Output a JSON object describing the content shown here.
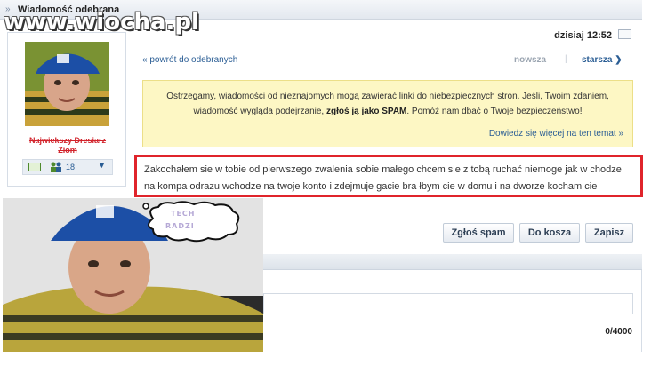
{
  "window": {
    "title": "Wiadomość odebrana"
  },
  "watermark": "www.wiocha.pl",
  "sender": {
    "nick": "Najwiekszy Dresiarz Ziom"
  },
  "profile_actions": {
    "friends_count": "18"
  },
  "header": {
    "date": "dzisiaj 12:52"
  },
  "nav": {
    "back": "« powrót do odebranych",
    "newer": "nowsza",
    "separator": "|",
    "older": "starsza ❯"
  },
  "warning": {
    "text_before": "Ostrzegamy, wiadomości od nieznajomych mogą zawierać linki do niebezpiecznych stron. Jeśli, Twoim zdaniem, wiadomość wygląda podejrzanie, ",
    "text_bold": "zgłoś ją jako SPAM",
    "text_after": ". Pomóż nam dbać o Twoje bezpieczeństwo!",
    "more_link": "Dowiedz się więcej na ten temat »"
  },
  "message": {
    "body": "Zakochałem sie w tobie od pierwszego zwalenia sobie małego chcem sie z tobą ruchać niemoge jak w chodze na kompa odrazu wchodze na twoje konto i zdejmuje gacie bra łbym cie w domu i na dworze kocham cie"
  },
  "speech_bubble": {
    "line1": "TECH",
    "line2": "RADZI"
  },
  "buttons": {
    "spam": "Zgłoś spam",
    "trash": "Do kosza",
    "save": "Zapisz"
  },
  "reply": {
    "char_count": "0/4000"
  },
  "colors": {
    "highlight_border": "#e0242b",
    "link": "#2a5d94",
    "warning_bg": "#fdf7c4"
  }
}
